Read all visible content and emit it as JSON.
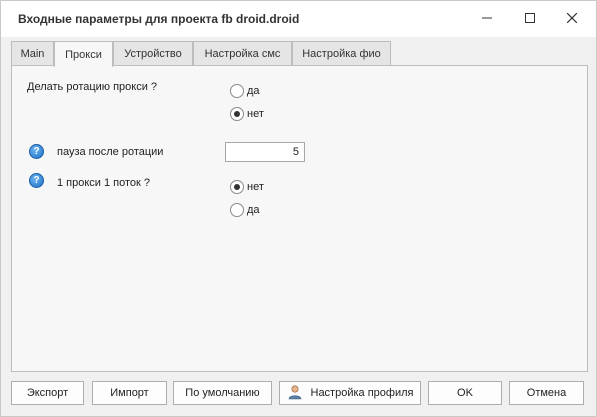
{
  "window": {
    "title": "Входные параметры для проекта fb droid.droid"
  },
  "tabs": [
    {
      "label": "Main",
      "active": false
    },
    {
      "label": "Прокси",
      "active": true
    },
    {
      "label": "Устройство",
      "active": false
    },
    {
      "label": "Настройка смс",
      "active": false
    },
    {
      "label": "Настройка фио",
      "active": false
    }
  ],
  "proxy_rotation": {
    "label": "Делать ротацию прокси ?",
    "options": [
      {
        "label": "да",
        "selected": false
      },
      {
        "label": "нет",
        "selected": true
      }
    ]
  },
  "pause_after_rotation": {
    "label": "пауза после ротации",
    "value": "5"
  },
  "one_proxy_one_thread": {
    "label": "1 прокси 1 поток ?",
    "options": [
      {
        "label": "нет",
        "selected": true
      },
      {
        "label": "да",
        "selected": false
      }
    ]
  },
  "footer": {
    "export_label": "Экспорт",
    "import_label": "Импорт",
    "default_label": "По умолчанию",
    "profile_settings_label": "Настройка профиля",
    "ok_label": "OK",
    "cancel_label": "Отмена"
  },
  "icons": {
    "minimize": "minimize-icon",
    "maximize": "maximize-icon",
    "close": "close-icon",
    "help": "help-icon",
    "profile": "user-profile-icon"
  },
  "colors": {
    "help_icon": "#1b6fc4",
    "background": "#f0f0f0"
  }
}
